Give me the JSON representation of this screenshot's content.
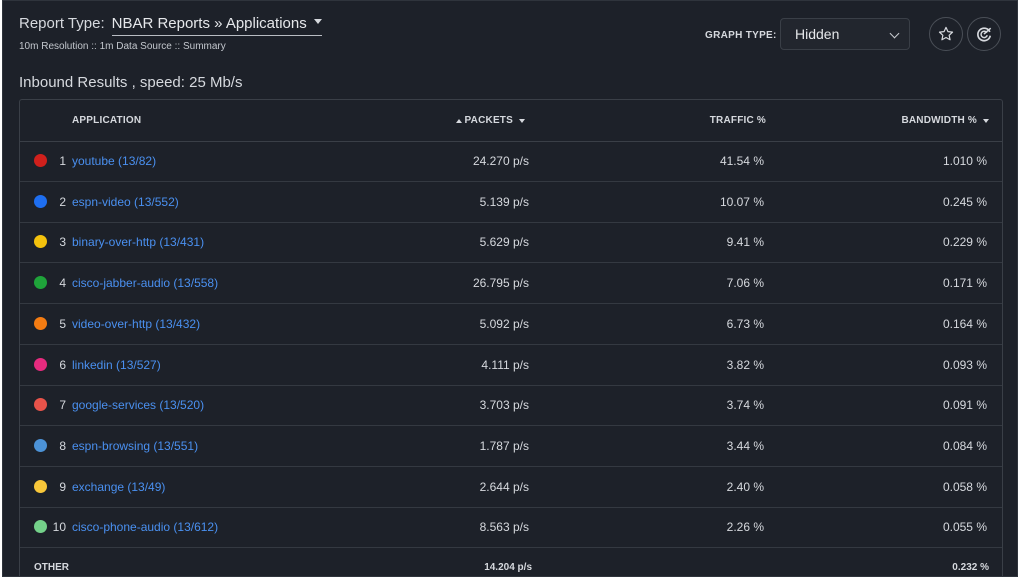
{
  "report": {
    "label": "Report Type:",
    "value": "NBAR Reports » Applications",
    "subline": "10m Resolution :: 1m Data Source :: Summary"
  },
  "graph": {
    "label": "GRAPH TYPE:",
    "selected": "Hidden"
  },
  "icons": {
    "favorite": "star-icon",
    "refresh": "refresh-icon"
  },
  "results_title": "Inbound Results , speed: 25 Mb/s",
  "table": {
    "headers": {
      "application": "APPLICATION",
      "packets": "PACKETS",
      "traffic": "TRAFFIC %",
      "bandwidth": "BANDWIDTH %"
    },
    "rows": [
      {
        "rank": "1",
        "app": "youtube (13/82)",
        "packets": "24.270 p/s",
        "traffic": "41.54 %",
        "bandwidth": "1.010 %",
        "color": "#d0201c"
      },
      {
        "rank": "2",
        "app": "espn-video (13/552)",
        "packets": "5.139 p/s",
        "traffic": "10.07 %",
        "bandwidth": "0.245 %",
        "color": "#1e6ef0"
      },
      {
        "rank": "3",
        "app": "binary-over-http (13/431)",
        "packets": "5.629 p/s",
        "traffic": "9.41 %",
        "bandwidth": "0.229 %",
        "color": "#f4c20d"
      },
      {
        "rank": "4",
        "app": "cisco-jabber-audio (13/558)",
        "packets": "26.795 p/s",
        "traffic": "7.06 %",
        "bandwidth": "0.171 %",
        "color": "#1fa33a"
      },
      {
        "rank": "5",
        "app": "video-over-http (13/432)",
        "packets": "5.092 p/s",
        "traffic": "6.73 %",
        "bandwidth": "0.164 %",
        "color": "#f47c12"
      },
      {
        "rank": "6",
        "app": "linkedin (13/527)",
        "packets": "4.111 p/s",
        "traffic": "3.82 %",
        "bandwidth": "0.093 %",
        "color": "#e62b7e"
      },
      {
        "rank": "7",
        "app": "google-services (13/520)",
        "packets": "3.703 p/s",
        "traffic": "3.74 %",
        "bandwidth": "0.091 %",
        "color": "#e8534a"
      },
      {
        "rank": "8",
        "app": "espn-browsing (13/551)",
        "packets": "1.787 p/s",
        "traffic": "3.44 %",
        "bandwidth": "0.084 %",
        "color": "#4c92d6"
      },
      {
        "rank": "9",
        "app": "exchange (13/49)",
        "packets": "2.644 p/s",
        "traffic": "2.40 %",
        "bandwidth": "0.058 %",
        "color": "#f8c73a"
      },
      {
        "rank": "10",
        "app": "cisco-phone-audio (13/612)",
        "packets": "8.563 p/s",
        "traffic": "2.26 %",
        "bandwidth": "0.055 %",
        "color": "#74d18a"
      }
    ],
    "other": {
      "label": "OTHER",
      "packets": "14.204 p/s",
      "bandwidth": "0.232 %"
    }
  }
}
